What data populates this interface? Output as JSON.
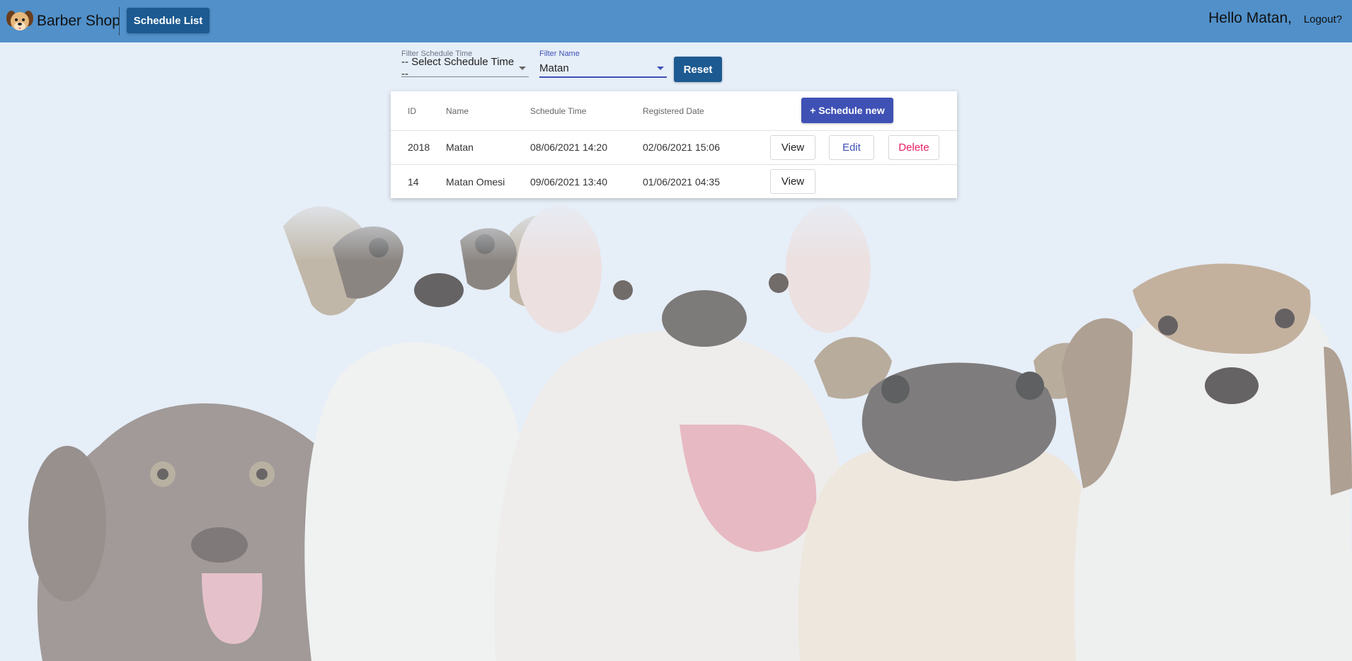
{
  "header": {
    "brand": "Barber Shop",
    "nav_button": "Schedule List",
    "greeting": "Hello Matan,",
    "logout": "Logout?"
  },
  "filters": {
    "time_label": "Filter Schedule Time",
    "time_value": "-- Select Schedule Time --",
    "name_label": "Filter Name",
    "name_value": "Matan",
    "reset": "Reset"
  },
  "table": {
    "columns": [
      "ID",
      "Name",
      "Schedule Time",
      "Registered Date"
    ],
    "schedule_new": "+ Schedule new",
    "rows": [
      {
        "id": "2018",
        "name": "Matan",
        "schedule_time": "08/06/2021 14:20",
        "registered": "02/06/2021 15:06",
        "view": "View",
        "edit": "Edit",
        "delete": "Delete"
      },
      {
        "id": "14",
        "name": "Matan Omesi",
        "schedule_time": "09/06/2021 13:40",
        "registered": "01/06/2021 04:35",
        "view": "View"
      }
    ]
  },
  "colors": {
    "header_bg": "#5190c9",
    "primary_dark": "#1c5a91",
    "accent": "#3f51b5",
    "danger": "#e91e63"
  },
  "icons": [
    "dog-logo-icon",
    "caret-down-icon"
  ]
}
